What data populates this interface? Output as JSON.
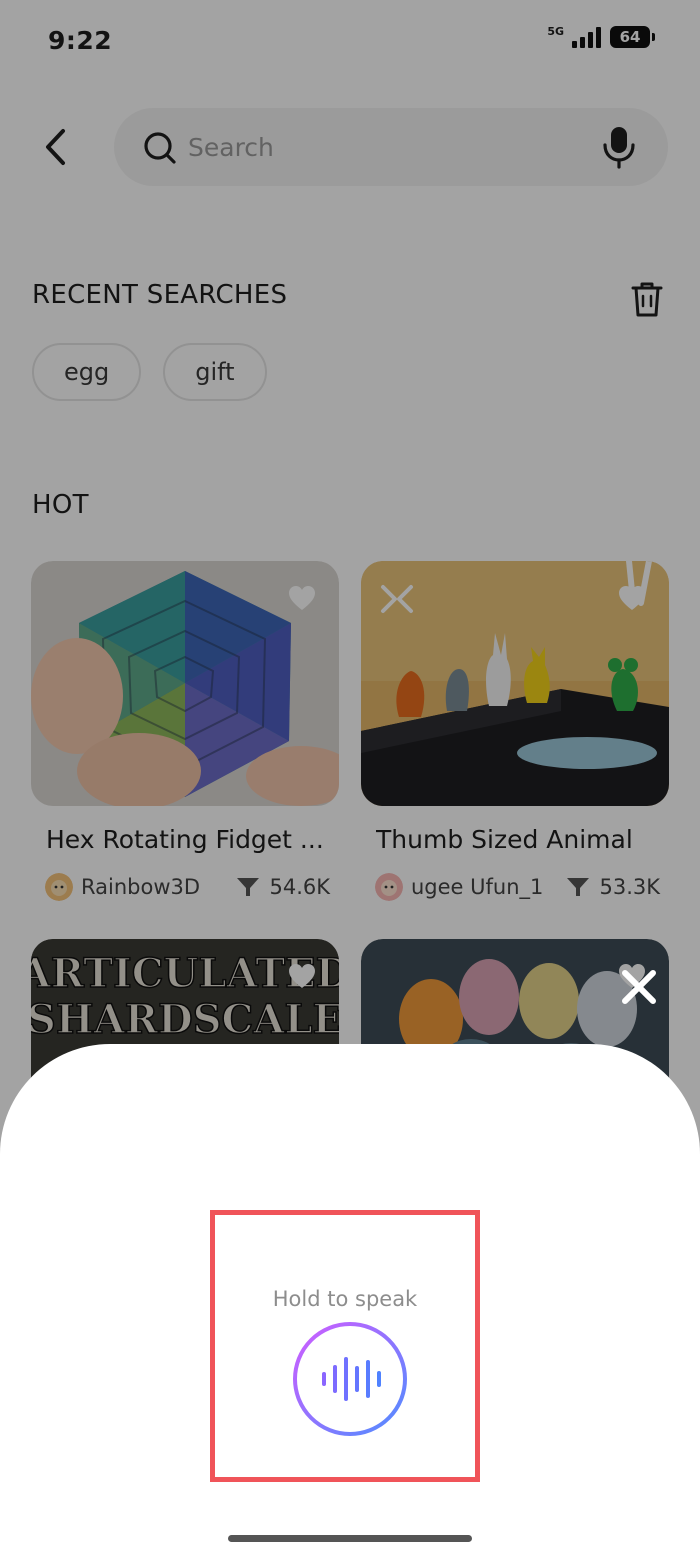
{
  "status_bar": {
    "time": "9:22",
    "network": "5G",
    "battery": "64"
  },
  "search": {
    "placeholder": "Search",
    "value": ""
  },
  "recent": {
    "title": "RECENT SEARCHES",
    "items": [
      "egg",
      "gift"
    ]
  },
  "hot": {
    "title": "HOT",
    "cards": [
      {
        "title": "Hex Rotating Fidget ...",
        "author": "Rainbow3D",
        "downloads": "54.6K"
      },
      {
        "title": "Thumb Sized Animal",
        "author": "ugee Ufun_1",
        "downloads": "53.3K"
      },
      {
        "image_text_line1": "ARTICULATED",
        "image_text_line2": "SHARDSCALE"
      },
      {}
    ]
  },
  "voice": {
    "hint": "Hold to speak"
  },
  "colors": {
    "overlay": "rgba(0,0,0,0.36)",
    "highlight_border": "#f05459",
    "voice_gradient_start": "#d15cff",
    "voice_gradient_end": "#4f8dff"
  },
  "icons": {
    "back": "chevron-left-icon",
    "search": "search-icon",
    "mic": "microphone-icon",
    "trash": "trash-icon",
    "favorite": "heart-icon",
    "close": "close-icon",
    "voice": "sound-wave-icon"
  }
}
